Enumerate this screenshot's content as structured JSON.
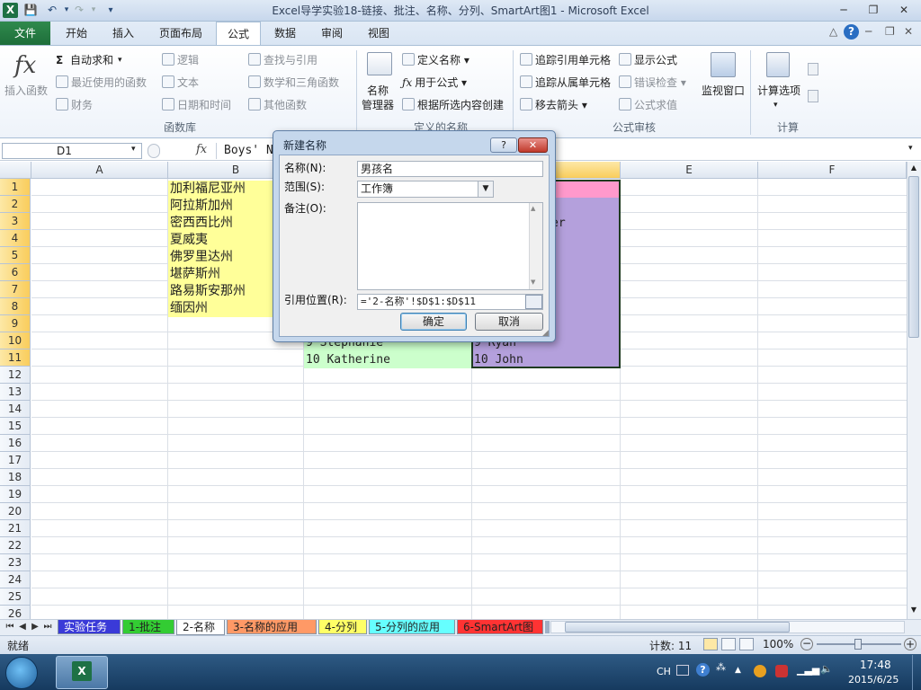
{
  "window": {
    "title": "Excel导学实验18-链接、批注、名称、分列、SmartArt图1  -  Microsoft Excel",
    "minimize": "─",
    "restore": "❐",
    "close": "✕"
  },
  "ribbon_tabs": [
    "文件",
    "开始",
    "插入",
    "页面布局",
    "公式",
    "数据",
    "审阅",
    "视图"
  ],
  "ribbon": {
    "insert_function": "插入函数",
    "autosum": "自动求和",
    "recent": "最近使用的函数",
    "finance": "财务",
    "logic": "逻辑",
    "text": "文本",
    "datetime": "日期和时间",
    "lookup": "查找与引用",
    "math": "数学和三角函数",
    "other": "其他函数",
    "group_library": "函数库",
    "name_manager_1": "名称",
    "name_manager_2": "管理器",
    "define_name": "定义名称",
    "use_in_formula": "用于公式",
    "create_from_selection": "根据所选内容创建",
    "group_names": "定义的名称",
    "trace_precedents": "追踪引用单元格",
    "trace_dependents": "追踪从属单元格",
    "remove_arrows": "移去箭头",
    "show_formulas": "显示公式",
    "error_checking": "错误检查",
    "evaluate": "公式求值",
    "group_audit": "公式审核",
    "watch": "监视窗口",
    "calc_options": "计算选项",
    "group_calc": "计算"
  },
  "formula_bar": {
    "name_box": "D1",
    "fx": "fx",
    "content": "Boys' N"
  },
  "columns": [
    "A",
    "B",
    "C",
    "D",
    "E",
    "F"
  ],
  "rows": [
    "1",
    "2",
    "3",
    "4",
    "5",
    "6",
    "7",
    "8",
    "9",
    "10",
    "11",
    "12",
    "13",
    "14",
    "15",
    "16",
    "17",
    "18",
    "19",
    "20",
    "21",
    "22",
    "23",
    "24",
    "25",
    "26"
  ],
  "column_b": [
    "加利福尼亚州",
    "阿拉斯加州",
    "密西西比州",
    "夏威夷",
    "佛罗里达州",
    "堪萨斯州",
    "路易斯安那州",
    "缅因州"
  ],
  "column_c_visible": {
    "row10": "9 Stephanie",
    "row11": "10 Katherine"
  },
  "column_d_visible": {
    "row3": "er",
    "row10": "9 Ryan",
    "row11": "10 John"
  },
  "dialog": {
    "title": "新建名称",
    "help": "?",
    "close": "✕",
    "name_label": "名称(N):",
    "name_value": "男孩名",
    "scope_label": "范围(S):",
    "scope_value": "工作簿",
    "comment_label": "备注(O):",
    "comment_value": "",
    "ref_label": "引用位置(R):",
    "ref_value": "='2-名称'!$D$1:$D$11",
    "ok": "确定",
    "cancel": "取消"
  },
  "sheet_tabs": [
    {
      "label": "实验任务",
      "color": "#3a3ad8"
    },
    {
      "label": "1-批注",
      "color": "#33cc33"
    },
    {
      "label": "2-名称",
      "color": "#ffffff"
    },
    {
      "label": "3-名称的应用",
      "color": "#ff9966"
    },
    {
      "label": "4-分列",
      "color": "#ffff66"
    },
    {
      "label": "5-分列的应用",
      "color": "#66ffff"
    },
    {
      "label": "6-SmartArt图",
      "color": "#ff3333"
    }
  ],
  "status": {
    "ready": "就绪",
    "count": "计数: 11",
    "zoom": "100%"
  },
  "taskbar": {
    "ime": "CH",
    "time": "17:48",
    "date": "2015/6/25"
  }
}
